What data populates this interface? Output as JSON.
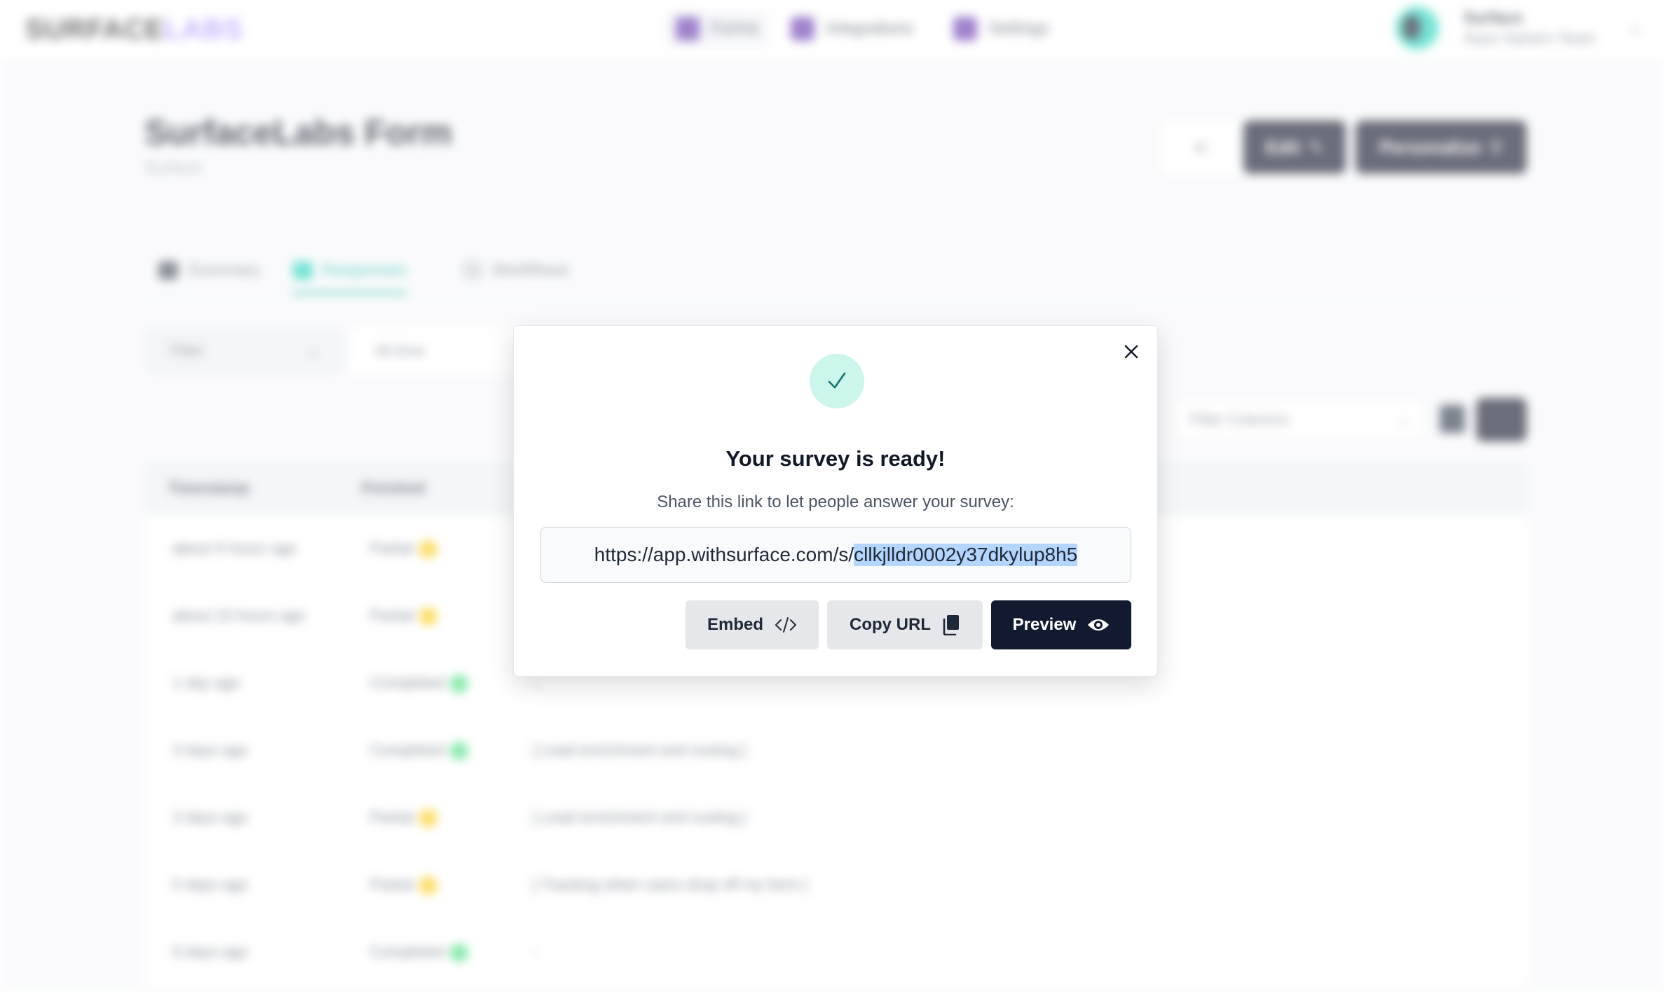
{
  "app": {
    "logo_part1": "SURFACE",
    "logo_part2": "LABS",
    "nav": [
      {
        "label": "Forms",
        "active": true
      },
      {
        "label": "Integrations",
        "active": false
      },
      {
        "label": "Settings",
        "active": false
      }
    ],
    "user": {
      "name": "Surface",
      "team": "Arjun Sahai's Team"
    }
  },
  "page": {
    "title": "SurfaceLabs Form",
    "subtitle": "Surface",
    "edit_label": "Edit",
    "personalize_label": "Personalize",
    "tabs": [
      {
        "label": "Summary",
        "active": false
      },
      {
        "label": "Responses",
        "active": true
      },
      {
        "label": "Workflows",
        "active": false
      }
    ],
    "filter_label": "Filter",
    "time_range": "All time",
    "filter_columns_placeholder": "Filter Columns"
  },
  "table": {
    "headers": [
      "Timestamp",
      "Finished"
    ],
    "rows": [
      {
        "timestamp": "about 9 hours ago",
        "status": "Partial",
        "answer": ""
      },
      {
        "timestamp": "about 10 hours ago",
        "status": "Partial",
        "answer": ""
      },
      {
        "timestamp": "1 day ago",
        "status": "Completed",
        "answer": "-"
      },
      {
        "timestamp": "3 days ago",
        "status": "Completed",
        "answer": "[ Lead enrichment and routing ]"
      },
      {
        "timestamp": "3 days ago",
        "status": "Partial",
        "answer": "[ Lead enrichment and routing ]"
      },
      {
        "timestamp": "5 days ago",
        "status": "Partial",
        "answer": "[ Tracking when users drop off my form ]"
      },
      {
        "timestamp": "6 days ago",
        "status": "Completed",
        "answer": "-"
      }
    ]
  },
  "modal": {
    "title": "Your survey is ready!",
    "subtitle": "Share this link to let people answer your survey:",
    "url_prefix": "https://app.withsurface.com/s/",
    "url_id": "cllkjlldr0002y37dkylup8h5",
    "embed_label": "Embed",
    "copy_label": "Copy URL",
    "preview_label": "Preview"
  },
  "colors": {
    "accent_teal": "#14b8a6",
    "partial": "#facc15",
    "completed": "#4ade80",
    "dark_button": "#111a2e"
  }
}
